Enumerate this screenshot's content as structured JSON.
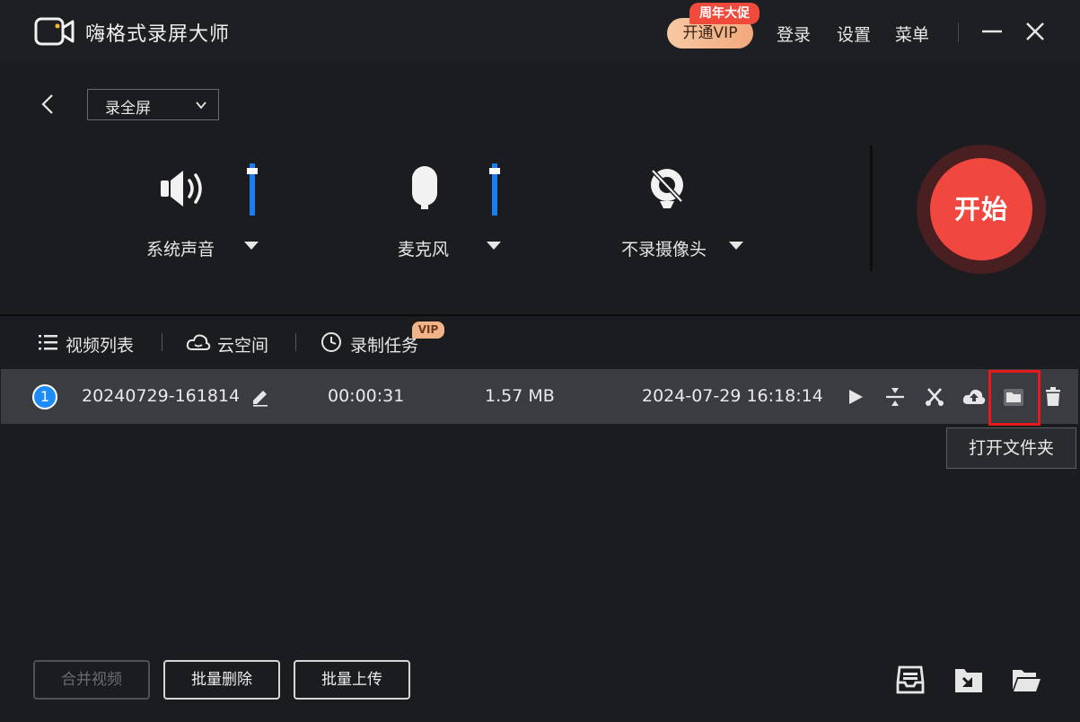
{
  "header": {
    "app_title": "嗨格式录屏大师",
    "vip_button": "开通VIP",
    "vip_badge": "周年大促",
    "login": "登录",
    "settings": "设置",
    "menu": "菜单"
  },
  "config": {
    "mode": "录全屏",
    "sources": [
      {
        "label": "系统声音",
        "icon": "speaker-icon",
        "volume": 0.9
      },
      {
        "label": "麦克风",
        "icon": "microphone-icon",
        "volume": 0.9
      },
      {
        "label": "不录摄像头",
        "icon": "camera-off-icon"
      }
    ],
    "start_label": "开始"
  },
  "tabs": [
    {
      "label": "视频列表",
      "icon": "list-icon"
    },
    {
      "label": "云空间",
      "icon": "cloud-icon"
    },
    {
      "label": "录制任务",
      "icon": "clock-icon",
      "badge": "VIP"
    }
  ],
  "files": [
    {
      "index": "1",
      "name": "20240729-161814",
      "duration": "00:00:31",
      "size": "1.57 MB",
      "date": "2024-07-29 16:18:14"
    }
  ],
  "tooltip": "打开文件夹",
  "bottom": {
    "merge": "合并视频",
    "batch_delete": "批量删除",
    "batch_upload": "批量上传"
  },
  "colors": {
    "accent_blue": "#1d8cf8",
    "start_red": "#f0473f",
    "highlight_red": "#e8191b",
    "vip_orange": "#f2a87c"
  }
}
